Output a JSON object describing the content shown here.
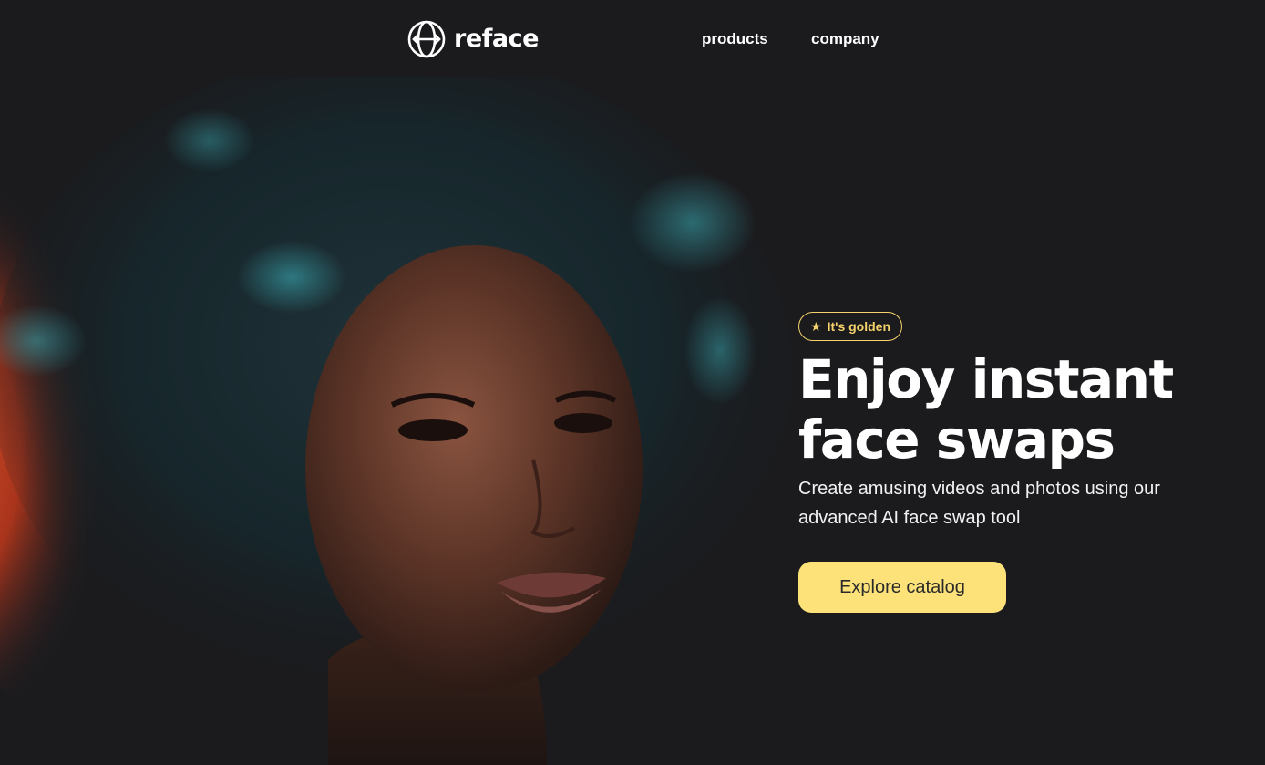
{
  "header": {
    "logo_text": "reface",
    "logo_icon": "reface-logo-icon",
    "nav": [
      {
        "label": "products"
      },
      {
        "label": "company"
      }
    ]
  },
  "hero": {
    "badge_icon": "star-icon",
    "badge_label": "It's golden",
    "headline_line1": "Enjoy instant",
    "headline_line2": "face swaps",
    "subtext": "Create amusing videos and photos using our advanced AI face swap tool",
    "cta_label": "Explore catalog",
    "image_subject": "portrait-photo"
  },
  "colors": {
    "background": "#1b1b1e",
    "accent": "#fde27a",
    "badge": "#f6d36b",
    "text": "#ffffff"
  }
}
